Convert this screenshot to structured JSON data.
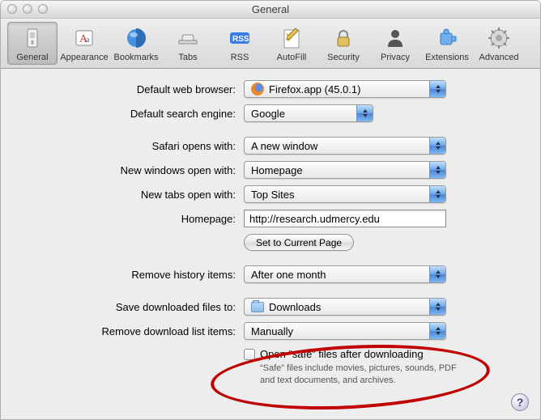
{
  "window": {
    "title": "General"
  },
  "toolbar": {
    "items": [
      {
        "label": "General"
      },
      {
        "label": "Appearance"
      },
      {
        "label": "Bookmarks"
      },
      {
        "label": "Tabs"
      },
      {
        "label": "RSS"
      },
      {
        "label": "AutoFill"
      },
      {
        "label": "Security"
      },
      {
        "label": "Privacy"
      },
      {
        "label": "Extensions"
      },
      {
        "label": "Advanced"
      }
    ]
  },
  "labels": {
    "default_browser": "Default web browser:",
    "default_search": "Default search engine:",
    "opens_with": "Safari opens with:",
    "new_windows": "New windows open with:",
    "new_tabs": "New tabs open with:",
    "homepage": "Homepage:",
    "set_current": "Set to Current Page",
    "remove_history": "Remove history items:",
    "save_downloads": "Save downloaded files to:",
    "remove_downloads": "Remove download list items:",
    "open_safe": "Open “safe” files after downloading",
    "safe_note": "“Safe” files include movies, pictures, sounds, PDF and text documents, and archives."
  },
  "values": {
    "default_browser": "Firefox.app (45.0.1)",
    "default_search": "Google",
    "opens_with": "A new window",
    "new_windows": "Homepage",
    "new_tabs": "Top Sites",
    "homepage": "http://research.udmercy.edu",
    "remove_history": "After one month",
    "save_downloads": "Downloads",
    "remove_downloads": "Manually"
  },
  "help": {
    "symbol": "?"
  }
}
